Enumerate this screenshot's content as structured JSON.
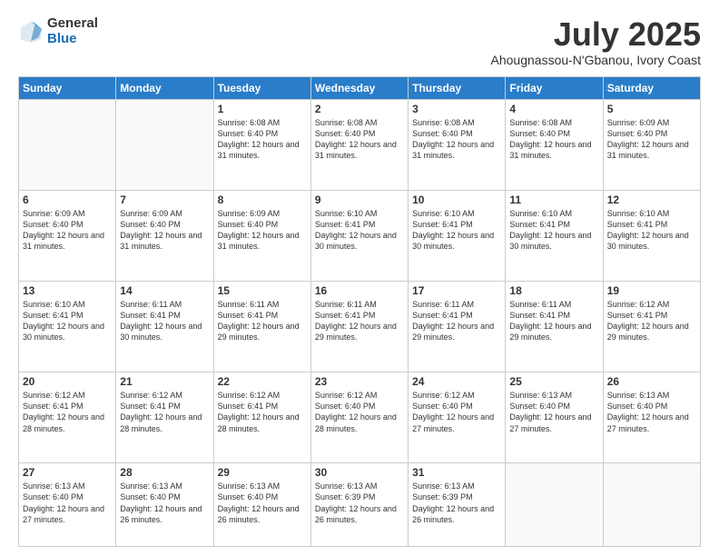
{
  "logo": {
    "general": "General",
    "blue": "Blue"
  },
  "title": {
    "month": "July 2025",
    "location": "Ahougnassou-N'Gbanou, Ivory Coast"
  },
  "weekdays": [
    "Sunday",
    "Monday",
    "Tuesday",
    "Wednesday",
    "Thursday",
    "Friday",
    "Saturday"
  ],
  "weeks": [
    [
      {
        "day": "",
        "info": ""
      },
      {
        "day": "",
        "info": ""
      },
      {
        "day": "1",
        "info": "Sunrise: 6:08 AM\nSunset: 6:40 PM\nDaylight: 12 hours and 31 minutes."
      },
      {
        "day": "2",
        "info": "Sunrise: 6:08 AM\nSunset: 6:40 PM\nDaylight: 12 hours and 31 minutes."
      },
      {
        "day": "3",
        "info": "Sunrise: 6:08 AM\nSunset: 6:40 PM\nDaylight: 12 hours and 31 minutes."
      },
      {
        "day": "4",
        "info": "Sunrise: 6:08 AM\nSunset: 6:40 PM\nDaylight: 12 hours and 31 minutes."
      },
      {
        "day": "5",
        "info": "Sunrise: 6:09 AM\nSunset: 6:40 PM\nDaylight: 12 hours and 31 minutes."
      }
    ],
    [
      {
        "day": "6",
        "info": "Sunrise: 6:09 AM\nSunset: 6:40 PM\nDaylight: 12 hours and 31 minutes."
      },
      {
        "day": "7",
        "info": "Sunrise: 6:09 AM\nSunset: 6:40 PM\nDaylight: 12 hours and 31 minutes."
      },
      {
        "day": "8",
        "info": "Sunrise: 6:09 AM\nSunset: 6:40 PM\nDaylight: 12 hours and 31 minutes."
      },
      {
        "day": "9",
        "info": "Sunrise: 6:10 AM\nSunset: 6:41 PM\nDaylight: 12 hours and 30 minutes."
      },
      {
        "day": "10",
        "info": "Sunrise: 6:10 AM\nSunset: 6:41 PM\nDaylight: 12 hours and 30 minutes."
      },
      {
        "day": "11",
        "info": "Sunrise: 6:10 AM\nSunset: 6:41 PM\nDaylight: 12 hours and 30 minutes."
      },
      {
        "day": "12",
        "info": "Sunrise: 6:10 AM\nSunset: 6:41 PM\nDaylight: 12 hours and 30 minutes."
      }
    ],
    [
      {
        "day": "13",
        "info": "Sunrise: 6:10 AM\nSunset: 6:41 PM\nDaylight: 12 hours and 30 minutes."
      },
      {
        "day": "14",
        "info": "Sunrise: 6:11 AM\nSunset: 6:41 PM\nDaylight: 12 hours and 30 minutes."
      },
      {
        "day": "15",
        "info": "Sunrise: 6:11 AM\nSunset: 6:41 PM\nDaylight: 12 hours and 29 minutes."
      },
      {
        "day": "16",
        "info": "Sunrise: 6:11 AM\nSunset: 6:41 PM\nDaylight: 12 hours and 29 minutes."
      },
      {
        "day": "17",
        "info": "Sunrise: 6:11 AM\nSunset: 6:41 PM\nDaylight: 12 hours and 29 minutes."
      },
      {
        "day": "18",
        "info": "Sunrise: 6:11 AM\nSunset: 6:41 PM\nDaylight: 12 hours and 29 minutes."
      },
      {
        "day": "19",
        "info": "Sunrise: 6:12 AM\nSunset: 6:41 PM\nDaylight: 12 hours and 29 minutes."
      }
    ],
    [
      {
        "day": "20",
        "info": "Sunrise: 6:12 AM\nSunset: 6:41 PM\nDaylight: 12 hours and 28 minutes."
      },
      {
        "day": "21",
        "info": "Sunrise: 6:12 AM\nSunset: 6:41 PM\nDaylight: 12 hours and 28 minutes."
      },
      {
        "day": "22",
        "info": "Sunrise: 6:12 AM\nSunset: 6:41 PM\nDaylight: 12 hours and 28 minutes."
      },
      {
        "day": "23",
        "info": "Sunrise: 6:12 AM\nSunset: 6:40 PM\nDaylight: 12 hours and 28 minutes."
      },
      {
        "day": "24",
        "info": "Sunrise: 6:12 AM\nSunset: 6:40 PM\nDaylight: 12 hours and 27 minutes."
      },
      {
        "day": "25",
        "info": "Sunrise: 6:13 AM\nSunset: 6:40 PM\nDaylight: 12 hours and 27 minutes."
      },
      {
        "day": "26",
        "info": "Sunrise: 6:13 AM\nSunset: 6:40 PM\nDaylight: 12 hours and 27 minutes."
      }
    ],
    [
      {
        "day": "27",
        "info": "Sunrise: 6:13 AM\nSunset: 6:40 PM\nDaylight: 12 hours and 27 minutes."
      },
      {
        "day": "28",
        "info": "Sunrise: 6:13 AM\nSunset: 6:40 PM\nDaylight: 12 hours and 26 minutes."
      },
      {
        "day": "29",
        "info": "Sunrise: 6:13 AM\nSunset: 6:40 PM\nDaylight: 12 hours and 26 minutes."
      },
      {
        "day": "30",
        "info": "Sunrise: 6:13 AM\nSunset: 6:39 PM\nDaylight: 12 hours and 26 minutes."
      },
      {
        "day": "31",
        "info": "Sunrise: 6:13 AM\nSunset: 6:39 PM\nDaylight: 12 hours and 26 minutes."
      },
      {
        "day": "",
        "info": ""
      },
      {
        "day": "",
        "info": ""
      }
    ]
  ]
}
